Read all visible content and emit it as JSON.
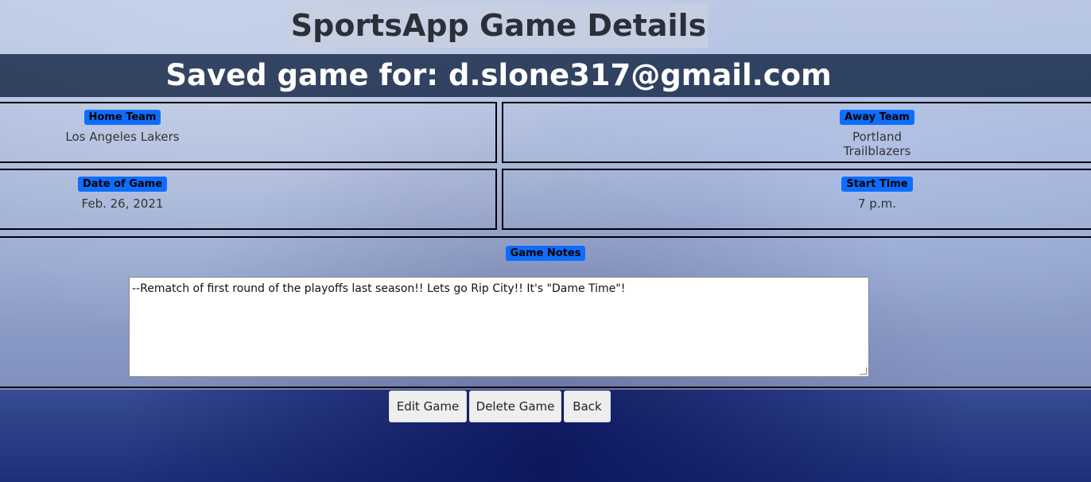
{
  "header": {
    "title": "SportsApp Game Details",
    "subtitle": "Saved game for: d.slone317@gmail.com"
  },
  "fields": {
    "home_team": {
      "label": "Home Team",
      "value": "Los Angeles Lakers"
    },
    "away_team": {
      "label": "Away Team",
      "value": "Portland Trailblazers"
    },
    "date": {
      "label": "Date of Game",
      "value": "Feb. 26, 2021"
    },
    "start_time": {
      "label": "Start Time",
      "value": "7 p.m."
    }
  },
  "notes": {
    "label": "Game Notes",
    "text": "--Rematch of first round of the playoffs last season!! Lets go Rip City!! It's \"Dame Time\"!"
  },
  "actions": {
    "edit": "Edit Game",
    "delete": "Delete Game",
    "back": "Back"
  }
}
